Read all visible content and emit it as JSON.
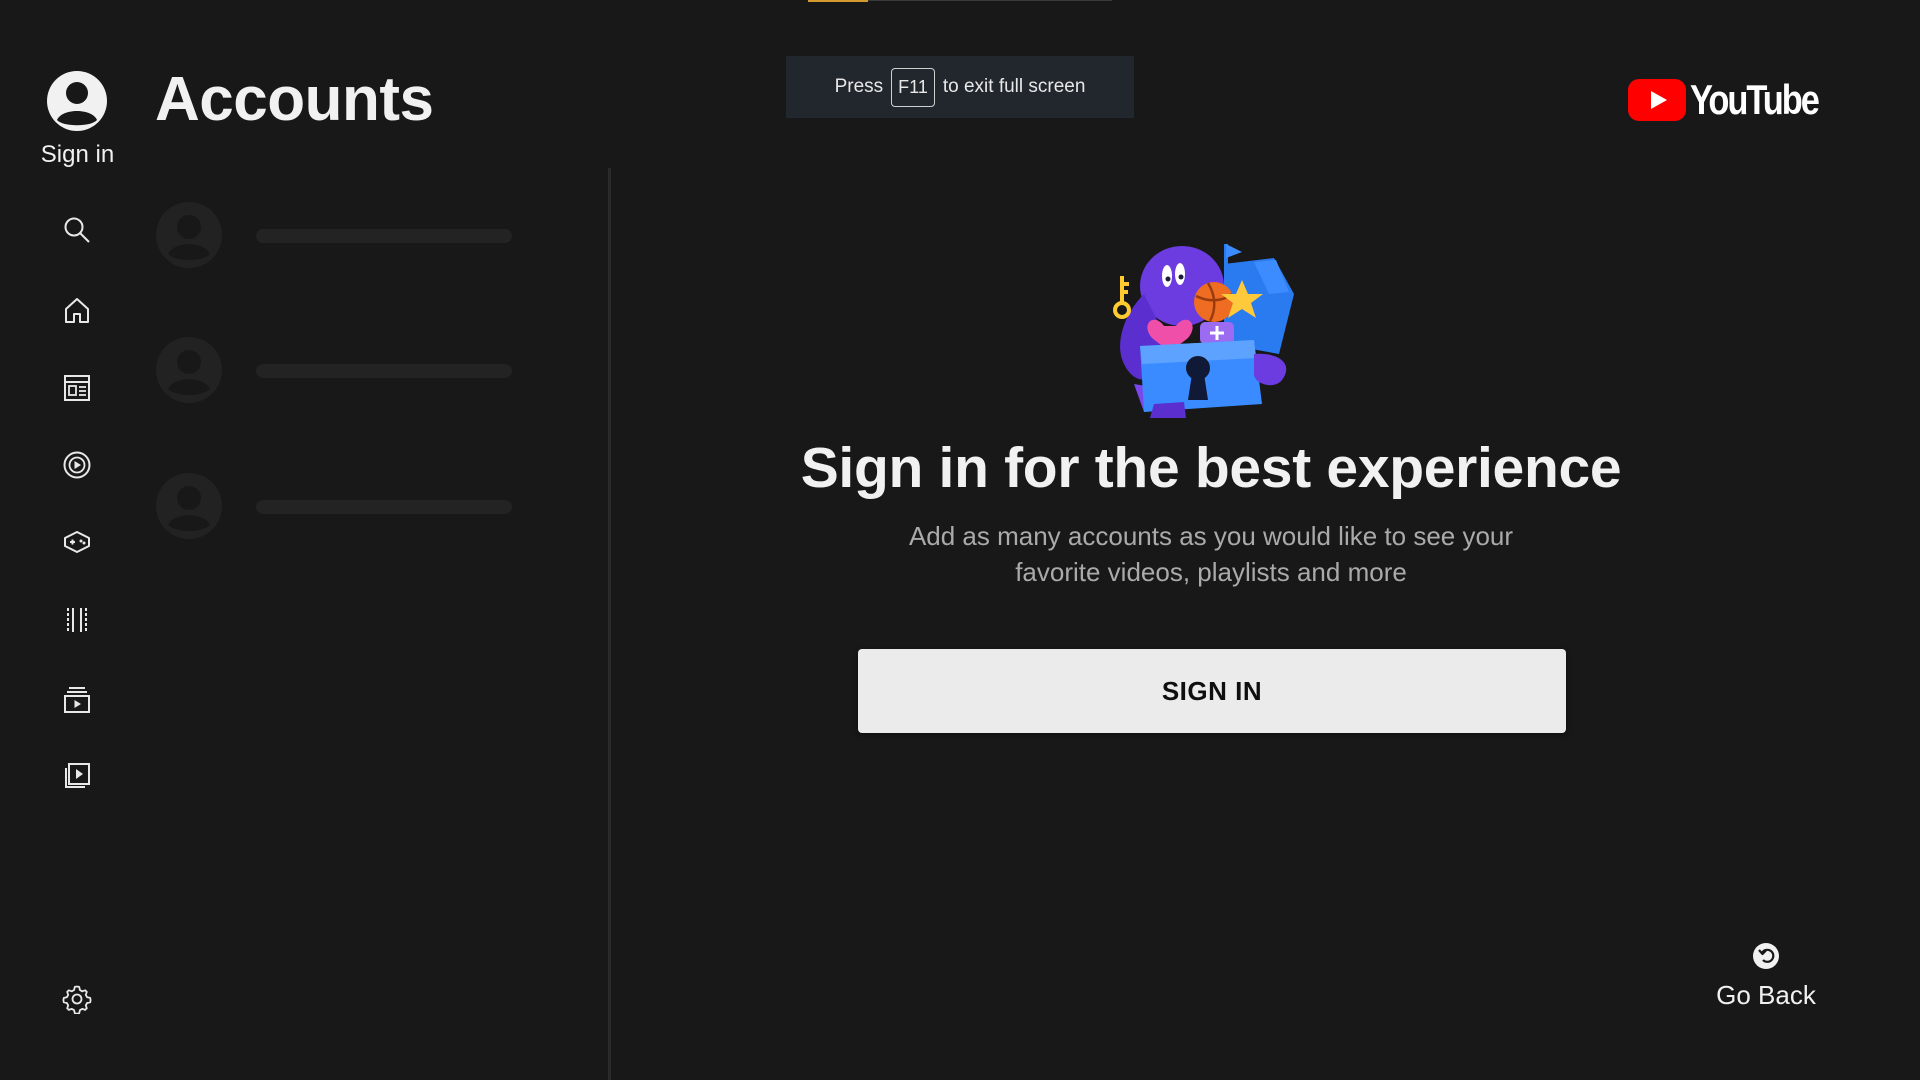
{
  "rail": {
    "signin_label": "Sign in",
    "items": [
      {
        "name": "search-icon"
      },
      {
        "name": "home-icon"
      },
      {
        "name": "subscriptions-icon"
      },
      {
        "name": "music-icon"
      },
      {
        "name": "gaming-icon"
      },
      {
        "name": "movies-icon"
      },
      {
        "name": "library-icon"
      },
      {
        "name": "playlist-icon"
      }
    ],
    "settings_icon": "gear-icon"
  },
  "accounts": {
    "title": "Accounts",
    "placeholders": 3
  },
  "fullscreen_toast": {
    "prefix": "Press",
    "key": "F11",
    "suffix": "to exit full screen"
  },
  "brand": {
    "logo_text": "YouTube",
    "red": "#ff0000"
  },
  "main": {
    "headline": "Sign in for the best experience",
    "subtext_line1": "Add as many accounts as you would like to see your",
    "subtext_line2": "favorite videos, playlists and more",
    "signin_button": "SIGN IN"
  },
  "go_back": {
    "label": "Go Back"
  },
  "colors": {
    "background": "#181818",
    "button_bg": "#ebebeb",
    "muted_text": "#aaaaaa"
  }
}
